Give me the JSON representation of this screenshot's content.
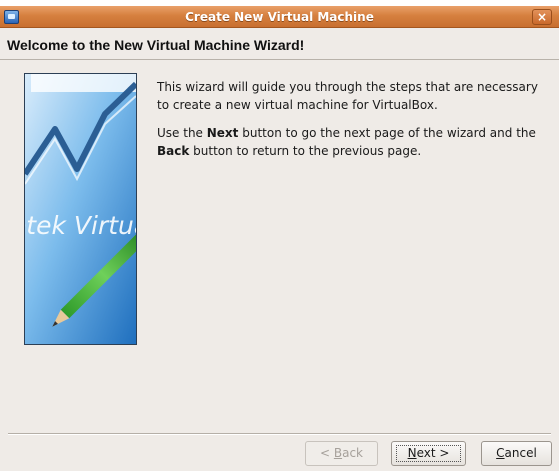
{
  "window": {
    "title": "Create New Virtual Machine",
    "close_glyph": "×",
    "icon": "virtualbox-app-icon"
  },
  "header": {
    "title": "Welcome to the New Virtual Machine Wizard!"
  },
  "side_image": {
    "watermark_text": "otek Virtua"
  },
  "body": {
    "paragraph1": "This wizard will guide you through the steps that are necessary to create a new virtual machine for VirtualBox.",
    "paragraph2": {
      "part1": "Use the ",
      "next_word": "Next",
      "part2": " button to go the next page of the wizard and the ",
      "back_word": "Back",
      "part3": " button to return to the previous page."
    }
  },
  "buttons": {
    "back": {
      "prefix": "< ",
      "mnemonic": "B",
      "rest": "ack",
      "enabled": false
    },
    "next": {
      "mnemonic": "N",
      "rest": "ext >",
      "enabled": true
    },
    "cancel": {
      "mnemonic": "C",
      "rest": "ancel",
      "enabled": true
    }
  },
  "colors": {
    "titlebar": "#d6803f",
    "window_bg": "#efebe7",
    "image_blue": "#3f93d8"
  }
}
